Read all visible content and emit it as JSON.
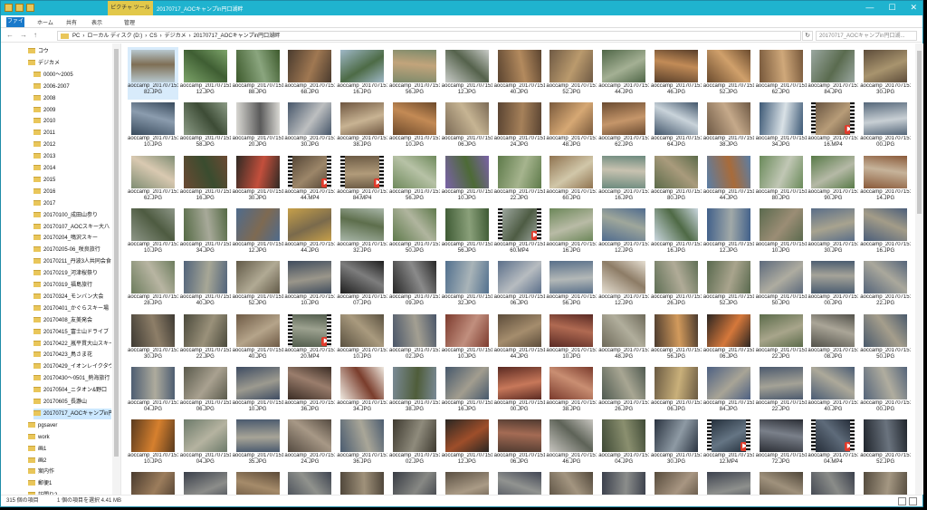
{
  "titlebar": {
    "context_tab": "ピクチャ ツール",
    "window_title": "20170717_AOCキャンプin円口湖畔",
    "minimize": "—",
    "maximize": "☐",
    "close": "✕"
  },
  "ribbon": {
    "file_tab": "ファイル",
    "tabs": [
      "ホーム",
      "共有",
      "表示",
      "管理"
    ]
  },
  "address": {
    "back": "←",
    "forward": "→",
    "up": "↑",
    "breadcrumbs": [
      "PC",
      "›",
      "ローカル ディスク (D:)",
      "›",
      "CS",
      "›",
      "デジカメ",
      "›",
      "20170717_AOCキャンプin円口湖畔"
    ],
    "refresh": "↻",
    "search_placeholder": "20170717_AOCキャンプin円口湖..."
  },
  "nav_tree": [
    {
      "label": "コウ",
      "indent": 0
    },
    {
      "label": "デジカメ",
      "indent": 0
    },
    {
      "label": "0000～2005",
      "indent": 1
    },
    {
      "label": "2006-2007",
      "indent": 1
    },
    {
      "label": "2008",
      "indent": 1
    },
    {
      "label": "2009",
      "indent": 1
    },
    {
      "label": "2010",
      "indent": 1
    },
    {
      "label": "2011",
      "indent": 1
    },
    {
      "label": "2012",
      "indent": 1
    },
    {
      "label": "2013",
      "indent": 1
    },
    {
      "label": "2014",
      "indent": 1
    },
    {
      "label": "2015",
      "indent": 1
    },
    {
      "label": "2016",
      "indent": 1
    },
    {
      "label": "2017",
      "indent": 1
    },
    {
      "label": "20170100_成田山参り",
      "indent": 1
    },
    {
      "label": "20170107_AOCスキー大八",
      "indent": 1
    },
    {
      "label": "20170204_鳴沢スキー",
      "indent": 1
    },
    {
      "label": "20170205-06_咲良旅行",
      "indent": 1
    },
    {
      "label": "20170211_丹波3人共同会食",
      "indent": 1
    },
    {
      "label": "20170219_河津桜祭り",
      "indent": 1
    },
    {
      "label": "20170319_福島旅行",
      "indent": 1
    },
    {
      "label": "20170324_モンバン大会",
      "indent": 1
    },
    {
      "label": "20170401_かぐらスキー場",
      "indent": 1
    },
    {
      "label": "20170408_友美発会",
      "indent": 1
    },
    {
      "label": "20170415_富士山ドライブ",
      "indent": 1
    },
    {
      "label": "20170422_嵐平貫大山スキー",
      "indent": 1
    },
    {
      "label": "20170423_鳥さま花",
      "indent": 1
    },
    {
      "label": "20170429_イオンレイクタウン",
      "indent": 1
    },
    {
      "label": "20170430～0501_熱海旅行",
      "indent": 1
    },
    {
      "label": "20170504_ニタオン&野口",
      "indent": 1
    },
    {
      "label": "20170605_長瀞山",
      "indent": 1
    },
    {
      "label": "20170717_AOCキャンプin円口",
      "indent": 1,
      "selected": true
    },
    {
      "label": "pgsaver",
      "indent": 0
    },
    {
      "label": "work",
      "indent": 0
    },
    {
      "label": "画1",
      "indent": 0
    },
    {
      "label": "画2",
      "indent": 0
    },
    {
      "label": "案内作",
      "indent": 0
    },
    {
      "label": "郵便1",
      "indent": 0
    },
    {
      "label": "訪問り2",
      "indent": 0
    }
  ],
  "files": [
    {
      "name": "aoccamp_20170715145882.JPG",
      "colors": [
        "#b7c8cf",
        "#7f6f55"
      ]
    },
    {
      "name": "aoccamp_20170715146612.JPG",
      "colors": [
        "#7da46a",
        "#3f5e33"
      ]
    },
    {
      "name": "aoccamp_20170715149588.JPG",
      "colors": [
        "#3d5a2c",
        "#8aa57e"
      ]
    },
    {
      "name": "aoccamp_20170715150068.JPG",
      "colors": [
        "#4a3b2e",
        "#a07852"
      ]
    },
    {
      "name": "aoccamp_20170715150116.JPG",
      "colors": [
        "#9fb8c7",
        "#4d6b46"
      ]
    },
    {
      "name": "aoccamp_20170715150156.JPG",
      "colors": [
        "#7c8a6b",
        "#c2a47b"
      ]
    },
    {
      "name": "aoccamp_20170715150712.JPG",
      "colors": [
        "#c9ccc8",
        "#55624c"
      ]
    },
    {
      "name": "aoccamp_20170715151240.JPG",
      "colors": [
        "#5b4430",
        "#b38a5e"
      ]
    },
    {
      "name": "aoccamp_20170715150052.JPG",
      "colors": [
        "#6f5a44",
        "#ba9a6d"
      ]
    },
    {
      "name": "aoccamp_20170715150044.JPG",
      "colors": [
        "#4f6647",
        "#a4b094"
      ]
    },
    {
      "name": "aoccamp_20170715152146.JPG",
      "colors": [
        "#593f2a",
        "#c28b57"
      ]
    },
    {
      "name": "aoccamp_20170715152252.JPG",
      "colors": [
        "#6b4b2e",
        "#d0a06b"
      ]
    },
    {
      "name": "aoccamp_20170715152262.JPG",
      "colors": [
        "#77583b",
        "#cfa87a"
      ]
    },
    {
      "name": "aoccamp_20170715152484.JPG",
      "colors": [
        "#9aa7a0",
        "#5a6b4f"
      ]
    },
    {
      "name": "aoccamp_20170715152730.JPG",
      "colors": [
        "#5d4c3a",
        "#a8946e"
      ]
    },
    {
      "name": "aoccamp_20170715152910.JPG",
      "colors": [
        "#384a5c",
        "#8b9cae"
      ]
    },
    {
      "name": "aoccamp_20170715152958.JPG",
      "colors": [
        "#8c9c86",
        "#3d4c36"
      ]
    },
    {
      "name": "aoccamp_20170715153520.JPG",
      "colors": [
        "#dad9d4",
        "#5a5a5a"
      ]
    },
    {
      "name": "aoccamp_20170715153630.JPG",
      "colors": [
        "#46566a",
        "#bdbfc0"
      ]
    },
    {
      "name": "aoccamp_20170715153638.JPG",
      "colors": [
        "#6e5640",
        "#c8b393"
      ]
    },
    {
      "name": "aoccamp_20170715154010.JPG",
      "colors": [
        "#6d4a2b",
        "#c38a55"
      ]
    },
    {
      "name": "aoccamp_20170715154206.JPG",
      "colors": [
        "#7b6a55",
        "#c6b493"
      ]
    },
    {
      "name": "aoccamp_20170715154324.JPG",
      "colors": [
        "#5a4432",
        "#a6815a"
      ]
    },
    {
      "name": "aoccamp_20170715154348.JPG",
      "colors": [
        "#7a5a3c",
        "#d6a874"
      ]
    },
    {
      "name": "aoccamp_20170715154362.JPG",
      "colors": [
        "#6a4b31",
        "#c5966a"
      ]
    },
    {
      "name": "aoccamp_20170715154664.JPG",
      "colors": [
        "#42566b",
        "#c9d3da"
      ]
    },
    {
      "name": "aoccamp_20170715154638.JPG",
      "colors": [
        "#6d5844",
        "#c5a98a"
      ]
    },
    {
      "name": "aoccamp_20170715154734.JPG",
      "colors": [
        "#3c5875",
        "#d9e1e6"
      ]
    },
    {
      "name": "aoccamp_20170715154816.MP4",
      "colors": [
        "#5f4c3a",
        "#b79c78"
      ],
      "video": true
    },
    {
      "name": "aoccamp_20170715154900.JPG",
      "colors": [
        "#55677a",
        "#c8cfd4"
      ]
    },
    {
      "name": "aoccamp_20170715155162.JPG",
      "colors": [
        "#7f8d73",
        "#d9c9b1"
      ]
    },
    {
      "name": "aoccamp_20170715155216.JPG",
      "colors": [
        "#6b4a33",
        "#3a4c2f"
      ]
    },
    {
      "name": "aoccamp_20170715155230.JPG",
      "colors": [
        "#2f2a24",
        "#c34f3c"
      ]
    },
    {
      "name": "aoccamp_20170715155244.MP4",
      "colors": [
        "#4d3f31",
        "#9c8669"
      ],
      "video": true
    },
    {
      "name": "aoccamp_20170715155284.MP4",
      "colors": [
        "#6b5a44",
        "#b19b7a"
      ],
      "video": true
    },
    {
      "name": "aoccamp_20170715155356.JPG",
      "colors": [
        "#6f8a5c",
        "#b7c2a6"
      ]
    },
    {
      "name": "aoccamp_20170715155410.JPG",
      "colors": [
        "#7a62a8",
        "#4d6a36"
      ]
    },
    {
      "name": "aoccamp_20170715155522.JPG",
      "colors": [
        "#5e7a4a",
        "#a6b48e"
      ]
    },
    {
      "name": "aoccamp_20170715155560.JPG",
      "colors": [
        "#8f7350",
        "#d1c7a9"
      ]
    },
    {
      "name": "aoccamp_20170715155616.JPG",
      "colors": [
        "#6c8a7e",
        "#c8c2b0"
      ]
    },
    {
      "name": "aoccamp_20170715155680.JPG",
      "colors": [
        "#5c6b4a",
        "#a99b7c"
      ]
    },
    {
      "name": "aoccamp_20170715155744.JPG",
      "colors": [
        "#5a7ea6",
        "#a86b3a"
      ]
    },
    {
      "name": "aoccamp_20170715155780.JPG",
      "colors": [
        "#6a8a5a",
        "#c1c7b5"
      ]
    },
    {
      "name": "aoccamp_20170715155890.JPG",
      "colors": [
        "#587a48",
        "#b5b9a6"
      ]
    },
    {
      "name": "aoccamp_20170715155914.JPG",
      "colors": [
        "#8a5a3a",
        "#c6b39a"
      ]
    },
    {
      "name": "aoccamp_20170715160210.JPG",
      "colors": [
        "#8d9687",
        "#4e5b41"
      ]
    },
    {
      "name": "aoccamp_20170715160234.JPG",
      "colors": [
        "#556a45",
        "#a7a999"
      ]
    },
    {
      "name": "aoccamp_20170715160512.JPG",
      "colors": [
        "#4f6b8c",
        "#7e6a52"
      ]
    },
    {
      "name": "aoccamp_20170715161244.JPG",
      "colors": [
        "#c7a04a",
        "#7a6a4c"
      ]
    },
    {
      "name": "aoccamp_20170715161832.JPG",
      "colors": [
        "#a8b6a8",
        "#5d6e4c"
      ]
    },
    {
      "name": "aoccamp_20170715162050.JPG",
      "colors": [
        "#5f7a4c",
        "#b0b59e"
      ]
    },
    {
      "name": "aoccamp_20170715162056.JPG",
      "colors": [
        "#3e5a34",
        "#8aa07a"
      ]
    },
    {
      "name": "aoccamp_20170715162160.MP4",
      "colors": [
        "#a7b0aa",
        "#4e5c44"
      ],
      "video": true
    },
    {
      "name": "aoccamp_20170715162216.JPG",
      "colors": [
        "#6c8759",
        "#b9bba6"
      ]
    },
    {
      "name": "aoccamp_20170715162612.JPG",
      "colors": [
        "#4f6b8e",
        "#9fa79b"
      ]
    },
    {
      "name": "aoccamp_20170715163316.JPG",
      "colors": [
        "#c9d6de",
        "#4f6a46"
      ]
    },
    {
      "name": "aoccamp_20170715163512.JPG",
      "colors": [
        "#41608a",
        "#a1a9a8"
      ]
    },
    {
      "name": "aoccamp_20170715163810.JPG",
      "colors": [
        "#5b6a4e",
        "#9b8d75"
      ]
    },
    {
      "name": "aoccamp_20170715163930.JPG",
      "colors": [
        "#5a6e88",
        "#a8a38f"
      ]
    },
    {
      "name": "aoccamp_20170715164316.JPG",
      "colors": [
        "#4b5e7a",
        "#a39c88"
      ]
    },
    {
      "name": "aoccamp_20170715164328.JPG",
      "colors": [
        "#6d7d5e",
        "#b8b5a2"
      ]
    },
    {
      "name": "aoccamp_20170715164340.JPG",
      "colors": [
        "#52647b",
        "#a7a796"
      ]
    },
    {
      "name": "aoccamp_20170715164352.JPG",
      "colors": [
        "#625a48",
        "#b1aa94"
      ]
    },
    {
      "name": "aoccamp_20170715164410.JPG",
      "colors": [
        "#3f4c5d",
        "#9a968a"
      ]
    },
    {
      "name": "aoccamp_20170715165007.JPG",
      "colors": [
        "#1e1e1e",
        "#7d7d7d"
      ]
    },
    {
      "name": "aoccamp_20170715165209.JPG",
      "colors": [
        "#272727",
        "#8a8a8a"
      ]
    },
    {
      "name": "aoccamp_20170715165432.JPG",
      "colors": [
        "#52708e",
        "#a9b4b8"
      ]
    },
    {
      "name": "aoccamp_20170715165506.JPG",
      "colors": [
        "#5b6f8a",
        "#b7bcc0"
      ]
    },
    {
      "name": "aoccamp_20170715165556.JPG",
      "colors": [
        "#59708a",
        "#b3b8b7"
      ]
    },
    {
      "name": "aoccamp_20170715165712.JPG",
      "colors": [
        "#e6dfd2",
        "#8d7c66"
      ]
    },
    {
      "name": "aoccamp_20170715165726.JPG",
      "colors": [
        "#5f6f55",
        "#b0ab97"
      ]
    },
    {
      "name": "aoccamp_20170715165752.JPG",
      "colors": [
        "#59694e",
        "#a9a48d"
      ]
    },
    {
      "name": "aoccamp_20170715165850.JPG",
      "colors": [
        "#5d6a7c",
        "#aeaca0"
      ]
    },
    {
      "name": "aoccamp_20170715165900.JPG",
      "colors": [
        "#4a5c70",
        "#a5a399"
      ]
    },
    {
      "name": "aoccamp_20170715170222.JPG",
      "colors": [
        "#54647a",
        "#aaa89c"
      ]
    },
    {
      "name": "aoccamp_20170715170230.JPG",
      "colors": [
        "#3e3a33",
        "#8d7e68"
      ]
    },
    {
      "name": "aoccamp_20170715170322.JPG",
      "colors": [
        "#4b4a3c",
        "#9a917a"
      ]
    },
    {
      "name": "aoccamp_20170715170740.JPG",
      "colors": [
        "#6e5a45",
        "#b5a48a"
      ]
    },
    {
      "name": "aoccamp_20170715170820.MP4",
      "colors": [
        "#4f5a4a",
        "#9ca18f"
      ],
      "video": true
    },
    {
      "name": "aoccamp_20170715171010.JPG",
      "colors": [
        "#5a5140",
        "#a99a7e"
      ]
    },
    {
      "name": "aoccamp_20170715171202.JPG",
      "colors": [
        "#4a5669",
        "#a39f92"
      ]
    },
    {
      "name": "aoccamp_20170715171610.JPG",
      "colors": [
        "#7d3b2e",
        "#c18f7e"
      ]
    },
    {
      "name": "aoccamp_20170715171644.JPG",
      "colors": [
        "#5c4c3a",
        "#a58d6d"
      ]
    },
    {
      "name": "aoccamp_20170715171910.JPG",
      "colors": [
        "#5a2a24",
        "#b06a52"
      ]
    },
    {
      "name": "aoccamp_20170715171948.JPG",
      "colors": [
        "#6e6a5a",
        "#b1ae9c"
      ]
    },
    {
      "name": "aoccamp_20170715172156.JPG",
      "colors": [
        "#4c3b2e",
        "#d29a5c"
      ]
    },
    {
      "name": "aoccamp_20170715172406.JPG",
      "colors": [
        "#2b2521",
        "#d5783b"
      ]
    },
    {
      "name": "aoccamp_20170715172422.JPG",
      "colors": [
        "#5b6b4a",
        "#a8a58b"
      ]
    },
    {
      "name": "aoccamp_20170715172708.JPG",
      "colors": [
        "#52514a",
        "#aaa597"
      ]
    },
    {
      "name": "aoccamp_20170715172850.JPG",
      "colors": [
        "#4a5a6c",
        "#a59e8c"
      ]
    },
    {
      "name": "aoccamp_20170715172904.JPG",
      "colors": [
        "#4e5e72",
        "#aeab9d"
      ]
    },
    {
      "name": "aoccamp_20170715174806.JPG",
      "colors": [
        "#5a5a4c",
        "#a9a190"
      ]
    },
    {
      "name": "aoccamp_20170715174910.JPG",
      "colors": [
        "#3e4c62",
        "#9c9a8f"
      ]
    },
    {
      "name": "aoccamp_20170715175036.JPG",
      "colors": [
        "#3a2c24",
        "#9a7d6c"
      ]
    },
    {
      "name": "aoccamp_20170715175134.JPG",
      "colors": [
        "#efe9e0",
        "#7a3d2c"
      ]
    },
    {
      "name": "aoccamp_20170715175238.JPG",
      "colors": [
        "#7a8a96",
        "#4f5d3a"
      ]
    },
    {
      "name": "aoccamp_20170715175316.JPG",
      "colors": [
        "#46586b",
        "#a29d8f"
      ]
    },
    {
      "name": "aoccamp_20170715180100.JPG",
      "colors": [
        "#5a2a22",
        "#c7785a"
      ]
    },
    {
      "name": "aoccamp_20170715180138.JPG",
      "colors": [
        "#7a3a2c",
        "#c98e72"
      ]
    },
    {
      "name": "aoccamp_20170715180426.JPG",
      "colors": [
        "#4f5a50",
        "#a8a693"
      ]
    },
    {
      "name": "aoccamp_20170715180506.JPG",
      "colors": [
        "#6a5a42",
        "#c9b07a"
      ]
    },
    {
      "name": "aoccamp_20170715180584.JPG",
      "colors": [
        "#4d6082",
        "#a8a496"
      ]
    },
    {
      "name": "aoccamp_20170715181022.JPG",
      "colors": [
        "#4c5a6e",
        "#a4a296"
      ]
    },
    {
      "name": "aoccamp_20170715181240.JPG",
      "colors": [
        "#4a5c74",
        "#ada99a"
      ]
    },
    {
      "name": "aoccamp_20170715181400.JPG",
      "colors": [
        "#54647a",
        "#b0ad9f"
      ]
    },
    {
      "name": "aoccamp_20170715182010.JPG",
      "colors": [
        "#5a3b1e",
        "#d6802e"
      ]
    },
    {
      "name": "aoccamp_20170715182104.JPG",
      "colors": [
        "#6c7a6a",
        "#b5b3a0"
      ]
    },
    {
      "name": "aoccamp_20170715183135.JPG",
      "colors": [
        "#4a5a6e",
        "#a7a497"
      ]
    },
    {
      "name": "aoccamp_20170715183624.JPG",
      "colors": [
        "#544a40",
        "#a79886"
      ]
    },
    {
      "name": "aoccamp_20170715183836.JPG",
      "colors": [
        "#4b5c70",
        "#a9a698"
      ]
    },
    {
      "name": "aoccamp_20170715184002.JPG",
      "colors": [
        "#3e3a30",
        "#8f8b7c"
      ]
    },
    {
      "name": "aoccamp_20170715184612.JPG",
      "colors": [
        "#2a2723",
        "#9e4e2a"
      ]
    },
    {
      "name": "aoccamp_20170715185006.JPG",
      "colors": [
        "#4f3a30",
        "#a46b54"
      ]
    },
    {
      "name": "aoccamp_20170715185446.JPG",
      "colors": [
        "#c7c5bf",
        "#5e6358"
      ]
    },
    {
      "name": "aoccamp_20170715190004.JPG",
      "colors": [
        "#3f4a36",
        "#8a8f6f"
      ]
    },
    {
      "name": "aoccamp_20170715190130.JPG",
      "colors": [
        "#2a3340",
        "#8e9aa4"
      ]
    },
    {
      "name": "aoccamp_20170715190312.MP4",
      "colors": [
        "#1f2a36",
        "#657584"
      ],
      "video": true
    },
    {
      "name": "aoccamp_20170715190472.JPG",
      "colors": [
        "#2b2e35",
        "#7a808a"
      ]
    },
    {
      "name": "aoccamp_20170715190904.MP4",
      "colors": [
        "#1e2530",
        "#5e6b7a"
      ],
      "video": true
    },
    {
      "name": "aoccamp_20170715191052.JPG",
      "colors": [
        "#20252c",
        "#6a737e"
      ]
    },
    {
      "name": "aoccamp_20170715191208.JPG",
      "colors": [
        "#4a3b2e",
        "#9c7d5c"
      ]
    },
    {
      "name": "aoccamp_20170715191420.JPG",
      "colors": [
        "#3a3f4a",
        "#8c8d8a"
      ]
    },
    {
      "name": "aoccamp_20170715191530.JPG",
      "colors": [
        "#5c4a38",
        "#a58b6a"
      ]
    },
    {
      "name": "aoccamp_20170715191610.JPG",
      "colors": [
        "#3e4450",
        "#90928d"
      ]
    },
    {
      "name": "aoccamp_20170715191744.JPG",
      "colors": [
        "#4f463a",
        "#9f917a"
      ]
    },
    {
      "name": "aoccamp_20170715191822.JPG",
      "colors": [
        "#383c44",
        "#878884"
      ]
    },
    {
      "name": "aoccamp_20170715191906.JPG",
      "colors": [
        "#5a4f42",
        "#aa9b86"
      ]
    },
    {
      "name": "aoccamp_20170715192004.JPG",
      "colors": [
        "#414654",
        "#919390"
      ]
    },
    {
      "name": "aoccamp_20170715192118.JPG",
      "colors": [
        "#52483b",
        "#a39580"
      ]
    },
    {
      "name": "aoccamp_20170715192226.JPG",
      "colors": [
        "#3b404c",
        "#8b8d8b"
      ]
    },
    {
      "name": "aoccamp_20170715192340.JPG",
      "colors": [
        "#574b3c",
        "#a89682"
      ]
    },
    {
      "name": "aoccamp_20170715192456.JPG",
      "colors": [
        "#3d424e",
        "#8e908d"
      ]
    },
    {
      "name": "aoccamp_20170715192518.JPG",
      "colors": [
        "#4e4538",
        "#9f917c"
      ]
    },
    {
      "name": "aoccamp_20170715192640.JPG",
      "colors": [
        "#3a3f4b",
        "#8a8c89"
      ]
    },
    {
      "name": "aoccamp_20170715192752.JPG",
      "colors": [
        "#534a3d",
        "#a49782"
      ]
    }
  ],
  "status": {
    "item_count": "315 個の項目",
    "selection": "1 個の項目を選択  4.41 MB"
  },
  "accent": "#1fb3cf",
  "video_badge_color": "#e03a2b",
  "selected_file_index": 0
}
